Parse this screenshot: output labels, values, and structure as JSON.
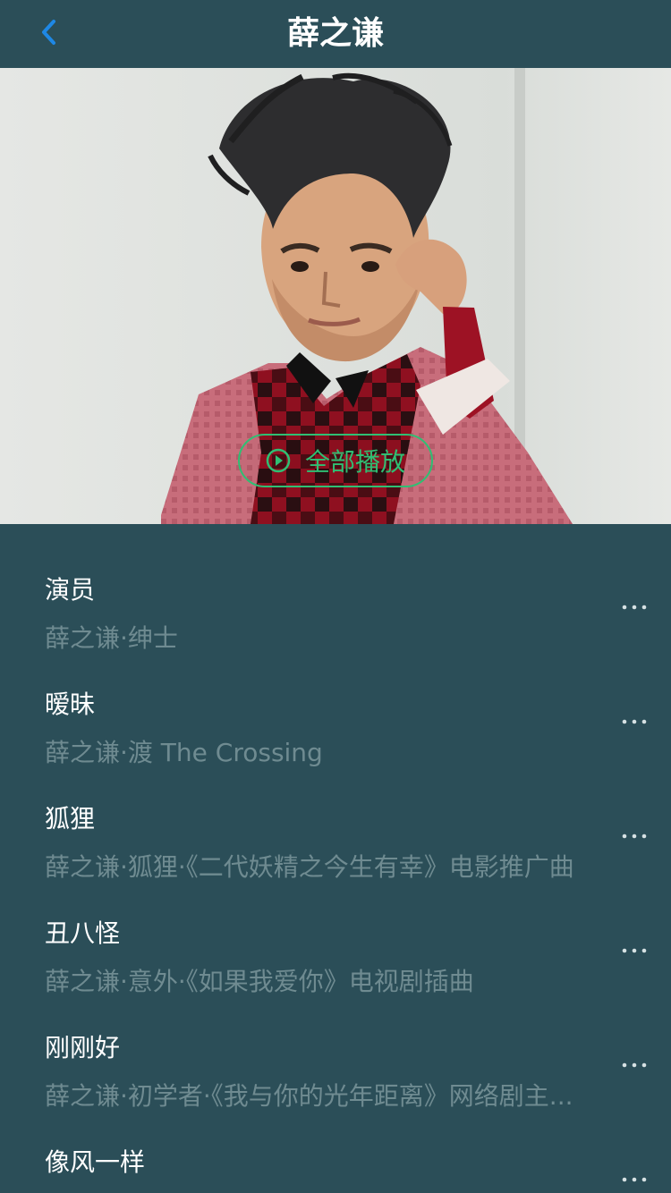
{
  "header": {
    "title": "薛之谦",
    "back_icon": "chevron-left-icon"
  },
  "hero": {
    "play_all_label": "全部播放",
    "play_icon": "play-circle-icon",
    "accent": "#2fbf73"
  },
  "songs": [
    {
      "title": "演员",
      "subtitle": "薛之谦·绅士"
    },
    {
      "title": "暧昧",
      "subtitle": "薛之谦·渡 The Crossing"
    },
    {
      "title": "狐狸",
      "subtitle": "薛之谦·狐狸·《二代妖精之今生有幸》电影推广曲"
    },
    {
      "title": "丑八怪",
      "subtitle": "薛之谦·意外·《如果我爱你》电视剧插曲"
    },
    {
      "title": "刚刚好",
      "subtitle": "薛之谦·初学者·《我与你的光年距离》网络剧主..."
    },
    {
      "title": "像风一样",
      "subtitle": ""
    }
  ],
  "colors": {
    "background": "#2b4e58",
    "title_text": "#ffffff",
    "subtitle_text": "#6f8b91",
    "accent": "#2fbf73",
    "back_icon": "#1e88e5"
  }
}
